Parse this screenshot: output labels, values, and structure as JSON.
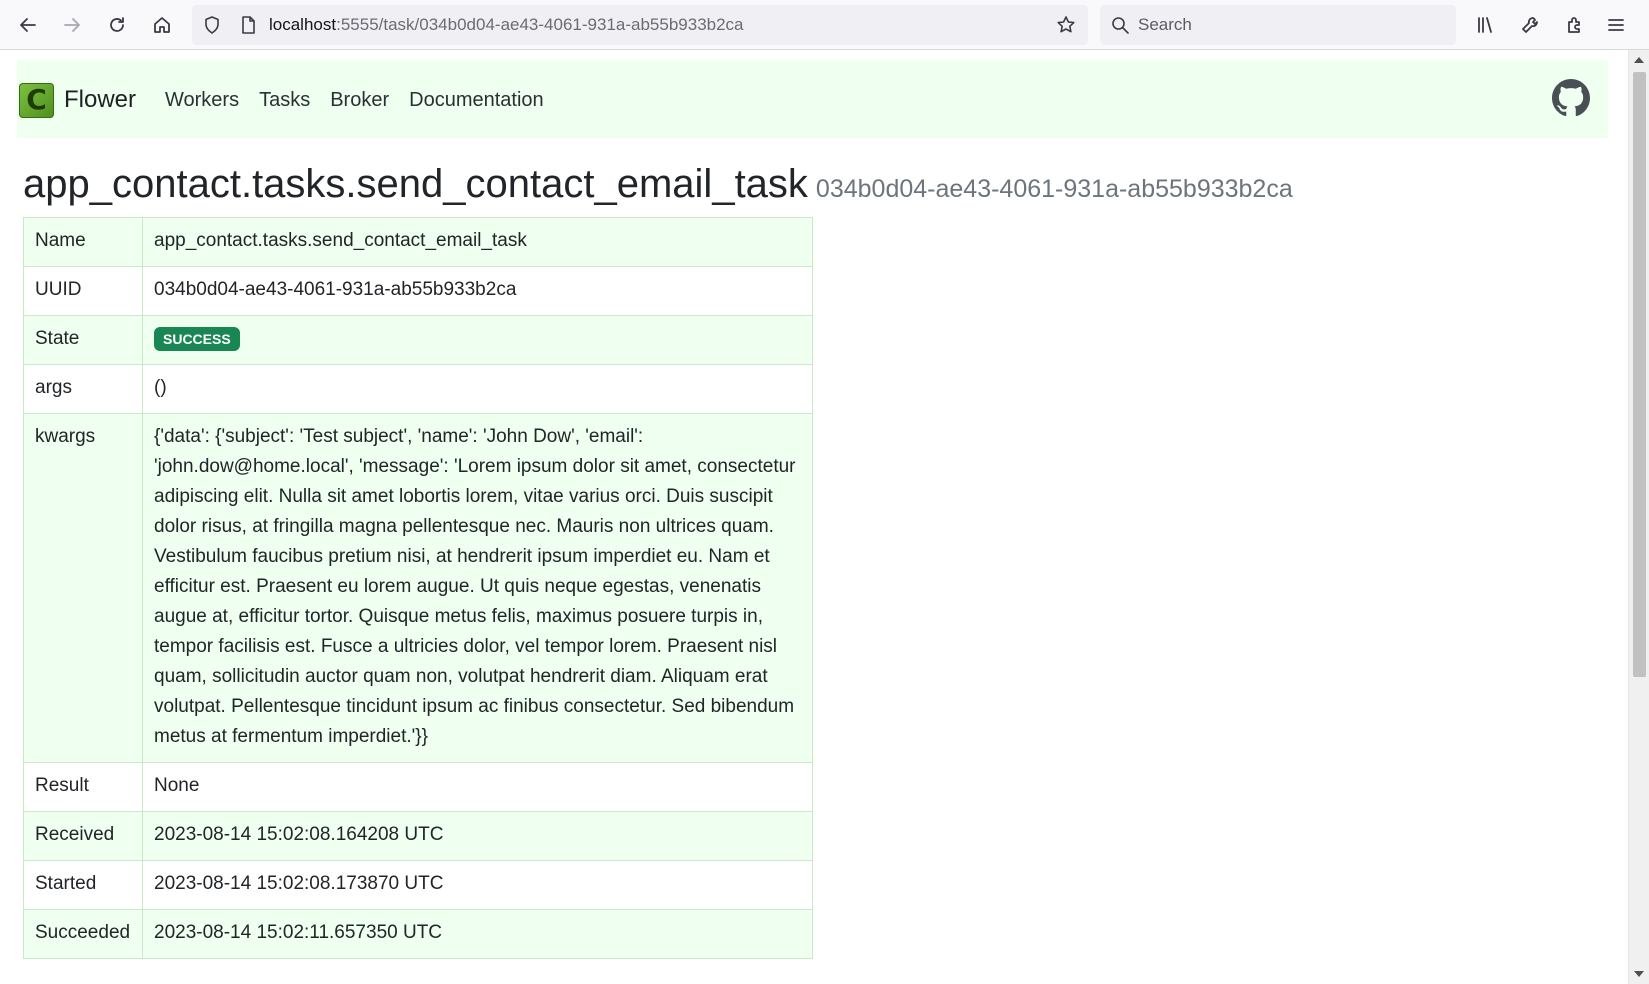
{
  "browser": {
    "url_host": "localhost",
    "url_rest": ":5555/task/034b0d04-ae43-4061-931a-ab55b933b2ca",
    "search_placeholder": "Search"
  },
  "navbar": {
    "logo_letter": "C",
    "brand": "Flower",
    "links": [
      "Workers",
      "Tasks",
      "Broker",
      "Documentation"
    ]
  },
  "page": {
    "title": "app_contact.tasks.send_contact_email_task",
    "subtitle": "034b0d04-ae43-4061-931a-ab55b933b2ca"
  },
  "task": {
    "name_label": "Name",
    "name": "app_contact.tasks.send_contact_email_task",
    "uuid_label": "UUID",
    "uuid": "034b0d04-ae43-4061-931a-ab55b933b2ca",
    "state_label": "State",
    "state": "SUCCESS",
    "args_label": "args",
    "args": "()",
    "kwargs_label": "kwargs",
    "kwargs": "{'data': {'subject': 'Test subject', 'name': 'John Dow', 'email': 'john.dow@home.local', 'message': 'Lorem ipsum dolor sit amet, consectetur adipiscing elit. Nulla sit amet lobortis lorem, vitae varius orci. Duis suscipit dolor risus, at fringilla magna pellentesque nec. Mauris non ultrices quam. Vestibulum faucibus pretium nisi, at hendrerit ipsum imperdiet eu. Nam et efficitur est. Praesent eu lorem augue. Ut quis neque egestas, venenatis augue at, efficitur tortor. Quisque metus felis, maximus posuere turpis in, tempor facilisis est. Fusce a ultricies dolor, vel tempor lorem. Praesent nisl quam, sollicitudin auctor quam non, volutpat hendrerit diam. Aliquam erat volutpat. Pellentesque tincidunt ipsum ac finibus consectetur. Sed bibendum metus at fermentum imperdiet.'}}",
    "result_label": "Result",
    "result": "None",
    "received_label": "Received",
    "received": "2023-08-14 15:02:08.164208 UTC",
    "started_label": "Started",
    "started": "2023-08-14 15:02:08.173870 UTC",
    "succeeded_label": "Succeeded",
    "succeeded": "2023-08-14 15:02:11.657350 UTC"
  },
  "colors": {
    "navbar_bg": "#effff0",
    "success_badge": "#198754",
    "subtitle": "#6c757d"
  }
}
